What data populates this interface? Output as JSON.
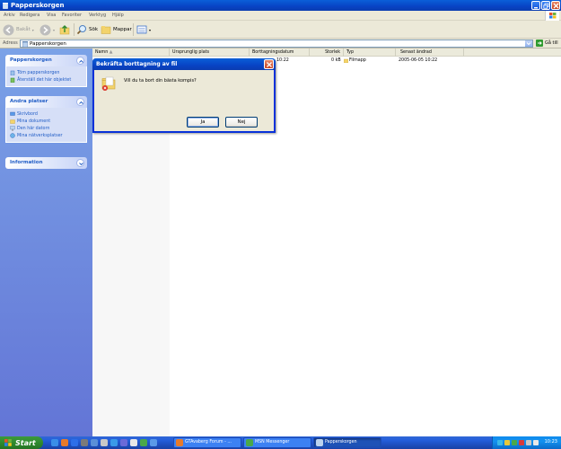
{
  "window": {
    "title": "Papperskorgen"
  },
  "menu": [
    "Arkiv",
    "Redigera",
    "Visa",
    "Favoriter",
    "Verktyg",
    "Hjälp"
  ],
  "toolbar": {
    "back": "Bakåt",
    "search": "Sök",
    "folders": "Mappar"
  },
  "address": {
    "label": "Adress",
    "value": "Papperskorgen",
    "go": "Gå till"
  },
  "taskpane": {
    "recycle": {
      "title": "Papperskorgen",
      "links": [
        "Töm papperskorgen",
        "Återställ det här objektet"
      ]
    },
    "places": {
      "title": "Andra platser",
      "links": [
        "Skrivbord",
        "Mina dokument",
        "Den här datorn",
        "Mina nätverksplatser"
      ]
    },
    "info": {
      "title": "Information"
    }
  },
  "columns": [
    "Namn",
    "Ursprunglig plats",
    "Borttagningsdatum",
    "Storlek",
    "Typ",
    "Senast ändrad"
  ],
  "row": {
    "deleted_tail": "10:22",
    "size": "0 kB",
    "type": "Filmapp",
    "modified": "2005-06-05 10:22"
  },
  "dialog": {
    "title": "Bekräfta borttagning av fil",
    "message": "Vill du ta bort din bästa kompis?",
    "yes": "Ja",
    "no": "Nej"
  },
  "taskbar": {
    "start": "Start",
    "tasks": [
      "GTAvaberg Forum - ...",
      "MSN Messenger",
      "Papperskorgen"
    ],
    "clock": "10:23"
  },
  "colors": {
    "xp_blue": "#0a3cb0",
    "start_green": "#2f8a2f",
    "link_blue": "#215dc6"
  }
}
